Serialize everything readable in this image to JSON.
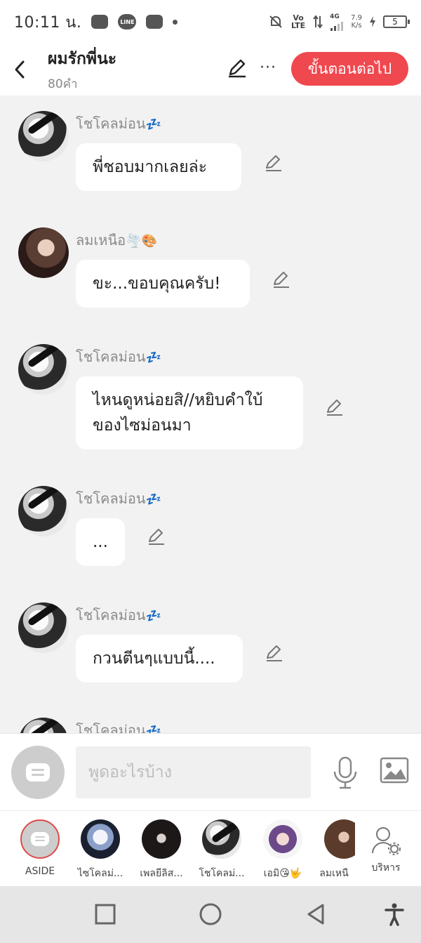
{
  "status_bar": {
    "time": "10:11 น.",
    "line_label": "LINE",
    "network_label": "Vo LTE",
    "signal_label": "4G",
    "speed_value": "7.9",
    "speed_unit": "K/s",
    "battery": "5"
  },
  "header": {
    "title": "ผมรักพี่นะ",
    "word_count": "80คำ",
    "next_button": "ขั้นตอนต่อไป",
    "more_label": "···"
  },
  "messages": [
    {
      "sender": "โชโคลม่อน",
      "emoji": "💤",
      "text": "พี่ชอบมากเลยล่ะ"
    },
    {
      "sender": "ลมเหนือ",
      "emoji": "🌪️🎨",
      "text": "ขะ...ขอบคุณครับ!"
    },
    {
      "sender": "โชโคลม่อน",
      "emoji": "💤",
      "text": "ไหนดูหน่อยสิ//หยิบคำใบ้ของไซม่อนมา"
    },
    {
      "sender": "โชโคลม่อน",
      "emoji": "💤",
      "text": "..."
    },
    {
      "sender": "โชโคลม่อน",
      "emoji": "💤",
      "text": "กวนตีนๆแบบนี้...."
    },
    {
      "sender": "โชโคลม่อน",
      "emoji": "💤",
      "text": ""
    }
  ],
  "input": {
    "placeholder": "พูดอะไรบ้าง"
  },
  "characters": [
    {
      "label": "ASIDE"
    },
    {
      "label": "ไซโคลม่..."
    },
    {
      "label": "เพลยีลิส..."
    },
    {
      "label": "โชโคลม่..."
    },
    {
      "label": "เอมิ😘🤟"
    },
    {
      "label": "ลมเหนื"
    }
  ],
  "manage": {
    "label": "บริหาร"
  },
  "colors": {
    "accent": "#f0484f",
    "background": "#f2f2f2"
  },
  "icons": {
    "back": "chevron-left-icon",
    "edit": "pencil-icon",
    "mic": "microphone-icon",
    "image": "image-icon",
    "manage": "user-gear-icon"
  }
}
